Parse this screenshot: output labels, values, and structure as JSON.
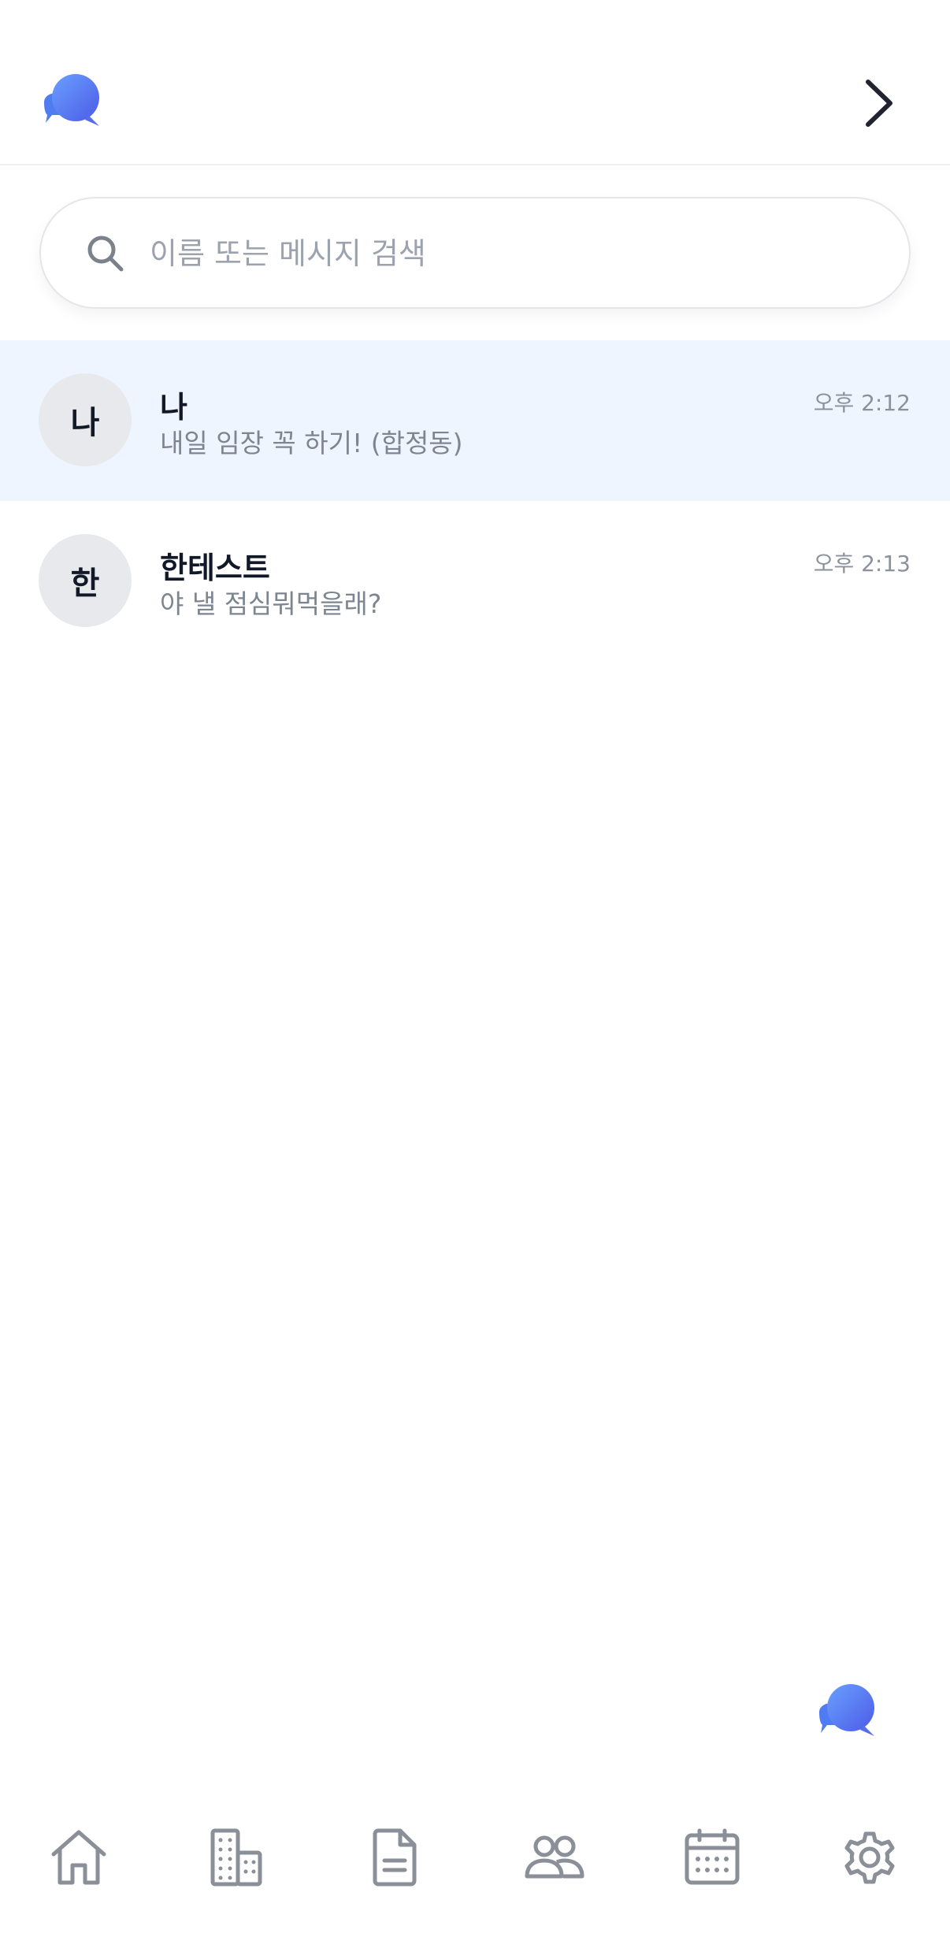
{
  "header": {
    "logo_icon": "chat-bubbles-icon",
    "next_icon": "chevron-right-icon"
  },
  "search": {
    "placeholder": "이름 또는 메시지 검색",
    "value": ""
  },
  "chats": [
    {
      "avatar": "나",
      "name": "나",
      "preview": "내일 임장 꼭 하기! (합정동)",
      "time": "오후 2:12",
      "selected": true
    },
    {
      "avatar": "한",
      "name": "한테스트",
      "preview": "야 낼 점심뭐먹을래?",
      "time": "오후 2:13",
      "selected": false
    }
  ],
  "fab": {
    "icon": "new-chat-icon"
  },
  "bottom_nav": {
    "items": [
      "home-icon",
      "building-icon",
      "document-icon",
      "people-icon",
      "calendar-icon",
      "settings-icon"
    ]
  },
  "colors": {
    "brand_gradient_start": "#5b8cf7",
    "brand_gradient_end": "#5b5ee8",
    "selected_row": "#eef5ff",
    "nav_icon": "#8a8f98"
  }
}
